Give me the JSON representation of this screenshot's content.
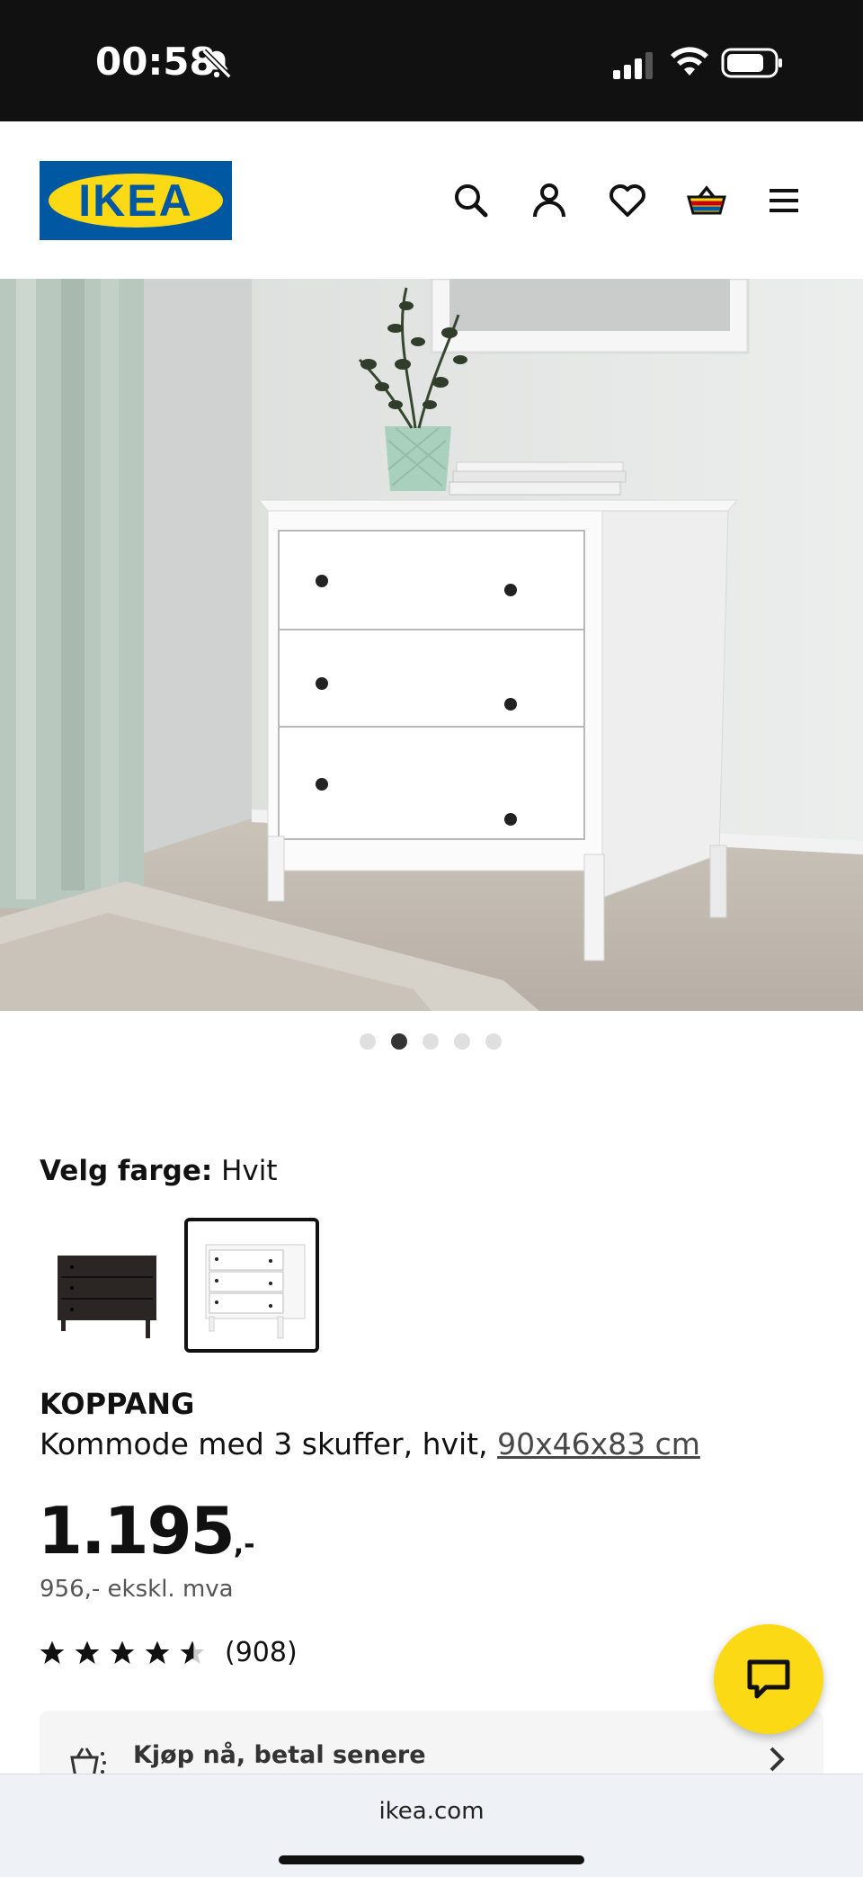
{
  "status_bar": {
    "time": "00:58"
  },
  "header": {
    "logo_text": "IKEA",
    "icons": [
      "search-icon",
      "profile-icon",
      "heart-icon",
      "basket-icon",
      "menu-icon"
    ]
  },
  "carousel": {
    "slide_count": 5,
    "active_index": 1
  },
  "color_picker": {
    "label": "Velg farge:",
    "selected": "Hvit",
    "options": [
      "black-brown",
      "white"
    ]
  },
  "product": {
    "name": "KOPPANG",
    "description": "Kommode med 3 skuffer, hvit, ",
    "dimensions": "90x46x83 cm",
    "price": "1.195",
    "price_suffix": ",-",
    "price_ex_vat": "956,- ekskl. mva",
    "rating": 4.5,
    "review_count": "(908)"
  },
  "buy_later": {
    "label": "Kjøp nå, betal senere"
  },
  "browser": {
    "url": "ikea.com"
  },
  "colors": {
    "brand_blue": "#0058A3",
    "brand_yellow": "#FBD914"
  }
}
